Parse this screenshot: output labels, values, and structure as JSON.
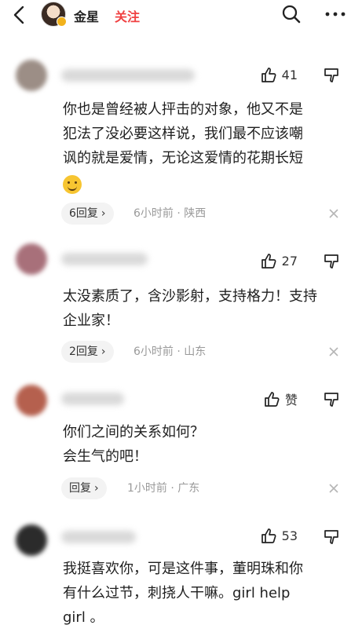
{
  "header": {
    "author_name": "金星",
    "follow_label": "关注"
  },
  "comments": [
    {
      "likes": "41",
      "lines": [
        "你也是曾经被人抨击的对象，他又不是",
        "犯法了没必要这样说，我们最不应该嘲",
        "讽的就是爱情，无论这爱情的花期长短"
      ],
      "emoji": "smile-emoji",
      "reply_label": "6回复",
      "time": "6小时前",
      "location": "陕西"
    },
    {
      "likes": "27",
      "lines": [
        "太没素质了，含沙影射，支持格力！支持",
        "企业家！"
      ],
      "reply_label": "2回复",
      "time": "6小时前",
      "location": "山东"
    },
    {
      "likes": "赞",
      "lines": [
        "你们之间的关系如何？",
        "会生气的吧！"
      ],
      "reply_label": "回复",
      "time": "1小时前",
      "location": "广东"
    },
    {
      "likes": "53",
      "lines": [
        "我挺喜欢你，可是这件事，董明珠和你",
        "有什么过节，刺挠人干嘛。girl help",
        "girl 。"
      ]
    }
  ],
  "separator": "·",
  "colors": {
    "follow": "#f04142",
    "meta": "#9a9a9a"
  }
}
